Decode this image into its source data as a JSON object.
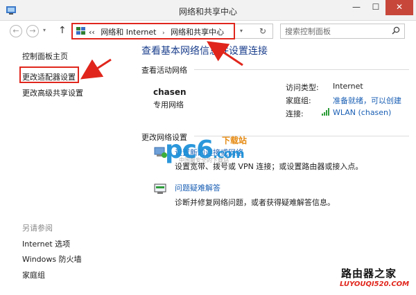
{
  "window": {
    "title": "网络和共享中心",
    "minimize": "—",
    "maximize": "☐",
    "close": "✕"
  },
  "toolbar": {
    "back": "←",
    "forward": "→",
    "dropdown": "▾",
    "up": "↑",
    "crumb_overflow": "‹‹",
    "crumbs": [
      "网络和 Internet",
      "网络和共享中心"
    ],
    "crumb_separator": "›",
    "address_dropdown": "▾",
    "refresh": "↻",
    "search_placeholder": "搜索控制面板"
  },
  "sidebar": {
    "home": "控制面板主页",
    "change_adapter": "更改适配器设置",
    "change_advanced": "更改高级共享设置",
    "see_also": "另请参阅",
    "internet_options": "Internet 选项",
    "firewall": "Windows 防火墙",
    "homegroup": "家庭组"
  },
  "main": {
    "title": "查看基本网络信息并设置连接",
    "active_networks_label": "查看活动网络",
    "network": {
      "name": "chasen",
      "type": "专用网络",
      "access_type_label": "访问类型:",
      "access_type_value": "Internet",
      "homegroup_label": "家庭组:",
      "homegroup_value": "准备就绪，可以创建",
      "connections_label": "连接:",
      "connections_value": "WLAN (chasen)"
    },
    "change_settings_label": "更改网络设置",
    "tasks": [
      {
        "link": "设置新的连接或网络",
        "desc": "设置宽带、拨号或 VPN 连接；或设置路由器或接入点。"
      },
      {
        "link": "问题疑难解答",
        "desc": "诊断并修复网络问题，或者获得疑难解答信息。"
      }
    ]
  },
  "watermarks": {
    "pc6": "pc6",
    "pc6_suffix": ".com",
    "xiazaizhan": "下载站",
    "pc6_sub": "中国最安全的下载站",
    "site_name": "路由器之家",
    "site_url": "LUYOUQI520.COM"
  },
  "colors": {
    "link": "#1a5fb4",
    "title": "#1a3e8c",
    "highlight": "#e0261c",
    "close_button": "#c7473a"
  }
}
